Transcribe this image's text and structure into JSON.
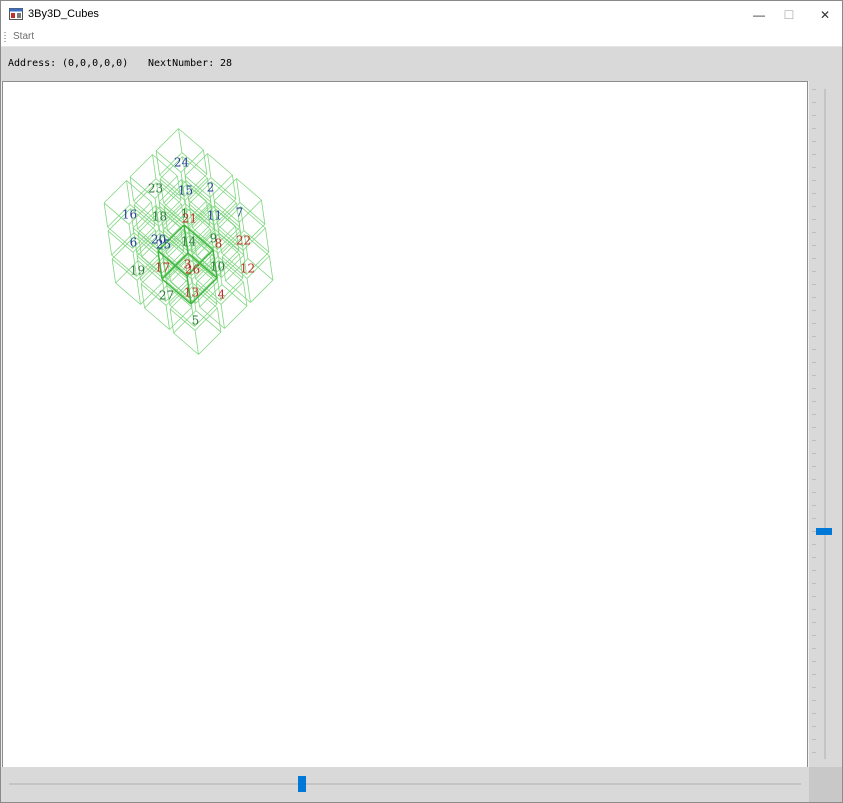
{
  "window": {
    "title": "3By3D_Cubes",
    "controls": {
      "minimize": "—",
      "maximize": "☐",
      "close": "✕"
    }
  },
  "menu": {
    "start_label": "Start"
  },
  "status": {
    "address_label": "Address:",
    "address_value": "(0,0,0,0,0)",
    "next_label": "NextNumber:",
    "next_value": "28"
  },
  "colors": {
    "wire": "#7ed67e",
    "highlight": "#3fb53f",
    "red": "#c0302a",
    "green": "#2f7a3a",
    "blue": "#243f96",
    "slider_thumb": "#0078d7"
  },
  "vertical_slider": {
    "value": 0.66
  },
  "horizontal_slider": {
    "value": 0.37
  },
  "cells": [
    {
      "n": "16",
      "c": "blue"
    },
    {
      "n": "23",
      "c": "green"
    },
    {
      "n": "24",
      "c": "blue"
    },
    {
      "n": "20",
      "c": "blue"
    },
    {
      "n": "1",
      "c": "green"
    },
    {
      "n": "2",
      "c": "blue"
    },
    {
      "n": "3",
      "c": "red"
    },
    {
      "n": "9",
      "c": "green"
    },
    {
      "n": "7",
      "c": "blue"
    },
    {
      "n": "6",
      "c": "blue"
    },
    {
      "n": "18",
      "c": "green"
    },
    {
      "n": "15",
      "c": "blue"
    },
    {
      "n": "17",
      "c": "red"
    },
    {
      "n": "14",
      "c": "green"
    },
    {
      "n": "11",
      "c": "blue"
    },
    {
      "n": "13",
      "c": "red"
    },
    {
      "n": "10",
      "c": "green"
    },
    {
      "n": "22",
      "c": "red"
    },
    {
      "n": "19",
      "c": "green"
    },
    {
      "n": "25",
      "c": "blue"
    },
    {
      "n": "21",
      "c": "red"
    },
    {
      "n": "27",
      "c": "green"
    },
    {
      "n": "26",
      "c": "red"
    },
    {
      "n": "8",
      "c": "red"
    },
    {
      "n": "5",
      "c": "green"
    },
    {
      "n": "4",
      "c": "red"
    },
    {
      "n": "12",
      "c": "red"
    }
  ]
}
